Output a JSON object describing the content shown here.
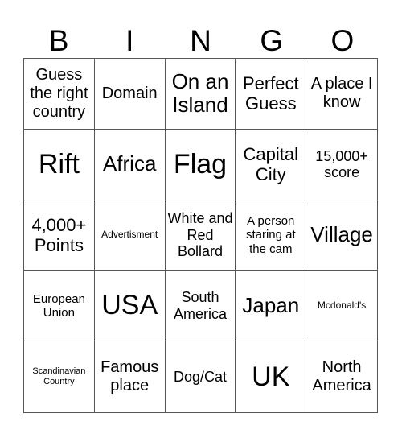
{
  "header": [
    "B",
    "I",
    "N",
    "G",
    "O"
  ],
  "cells": [
    "Guess the right country",
    "Domain",
    "On an Island",
    "Perfect Guess",
    "A place I know",
    "Rift",
    "Africa",
    "Flag",
    "Capital City",
    "15,000+ score",
    "4,000+ Points",
    "Advertisment",
    "White and Red Bollard",
    "A person staring at the cam",
    "Village",
    "European Union",
    "USA",
    "South America",
    "Japan",
    "Mcdonald's",
    "Scandinavian Country",
    "Famous place",
    "Dog/Cat",
    "UK",
    "North America"
  ]
}
